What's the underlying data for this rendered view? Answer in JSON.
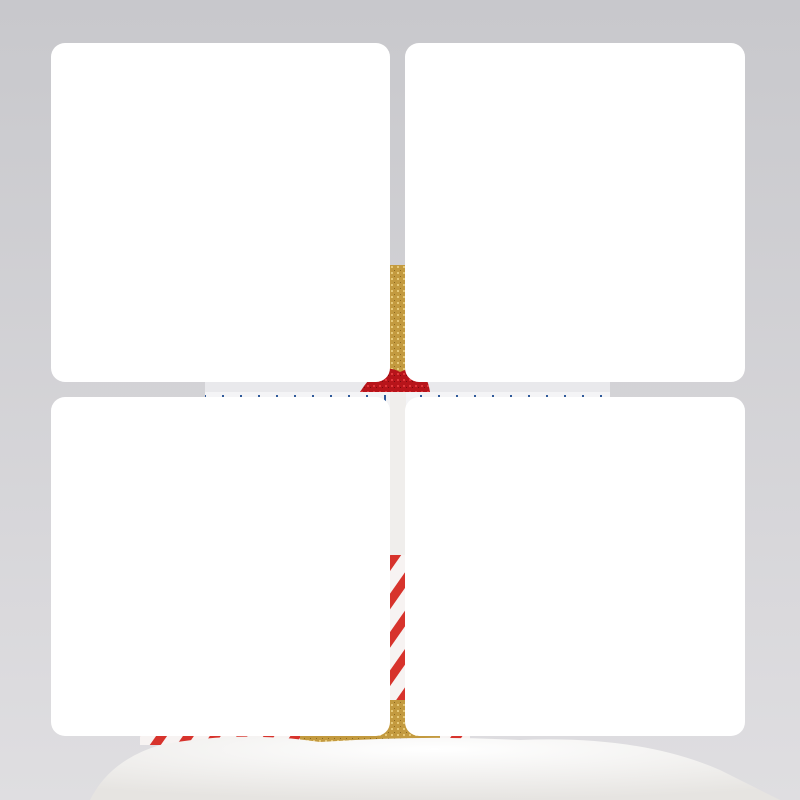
{
  "scene": {
    "subject": "gift-box-stack",
    "colors": {
      "wall_top": "#c9c9cd",
      "wall_bottom": "#dedde0",
      "gold_ribbon": "#c9a24a",
      "red_glitter": "#c0171b",
      "white_paper": "#f3f3f5",
      "blue_dash": "#2f5a9a",
      "red_stripe": "#d7332c",
      "fur": "#f4f3f1"
    }
  },
  "cards": [
    {
      "id": "card-tl",
      "color": "#ffffff"
    },
    {
      "id": "card-tr",
      "color": "#ffffff"
    },
    {
      "id": "card-bl",
      "color": "#ffffff"
    },
    {
      "id": "card-br",
      "color": "#ffffff"
    }
  ]
}
